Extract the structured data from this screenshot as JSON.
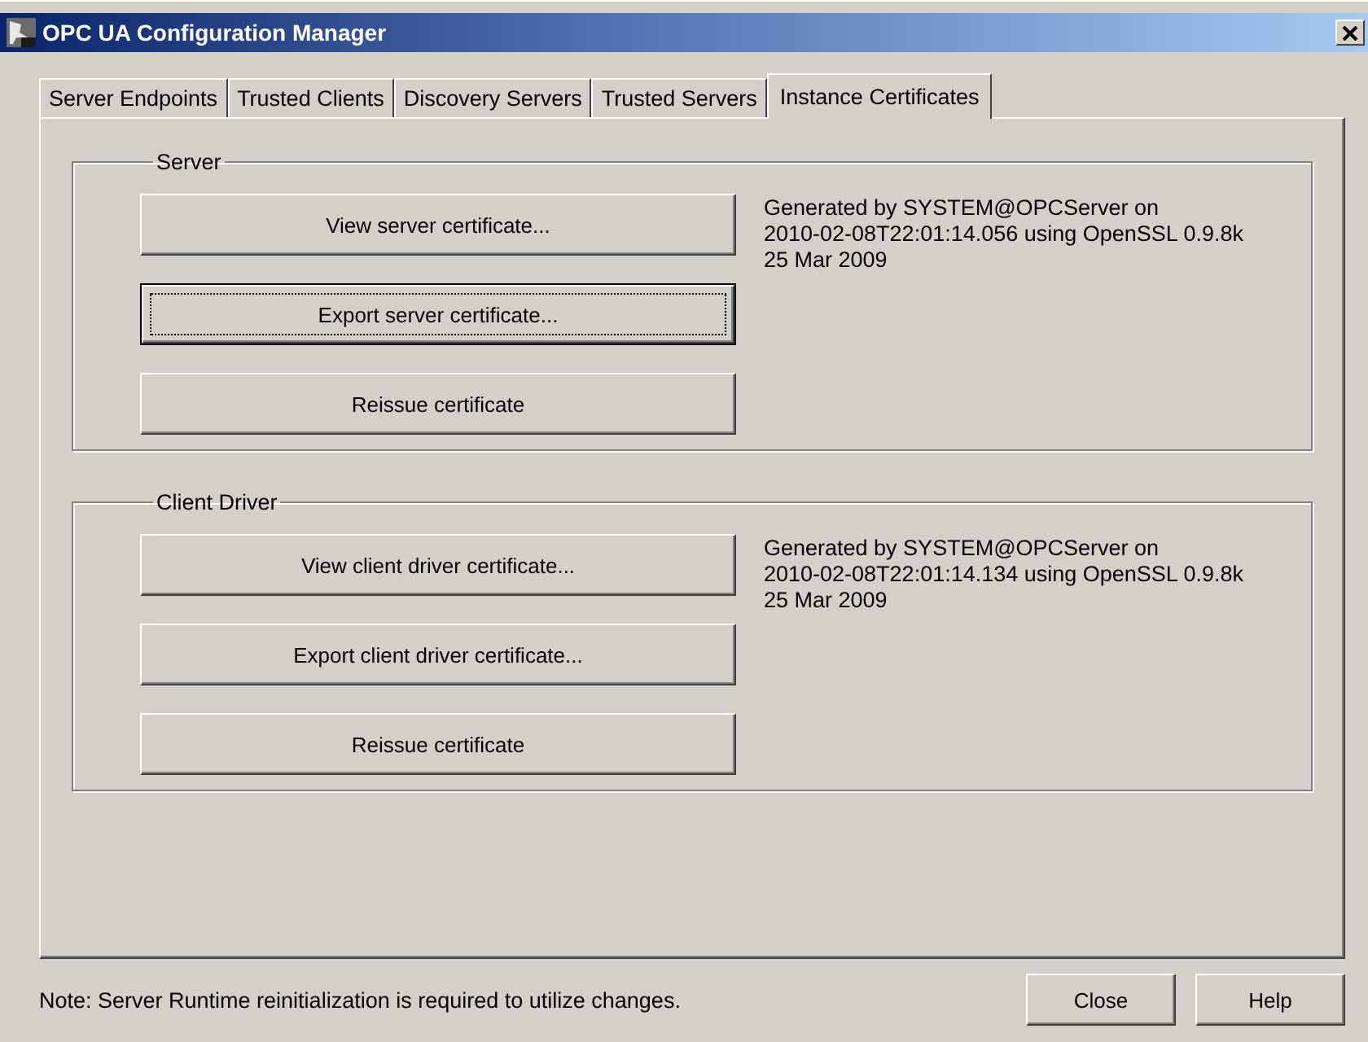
{
  "window": {
    "title": "OPC UA Configuration Manager"
  },
  "tabs": [
    {
      "label": "Server Endpoints",
      "selected": false
    },
    {
      "label": "Trusted Clients",
      "selected": false
    },
    {
      "label": "Discovery Servers",
      "selected": false
    },
    {
      "label": "Trusted Servers",
      "selected": false
    },
    {
      "label": "Instance Certificates",
      "selected": true
    }
  ],
  "groups": [
    {
      "title": "Server",
      "info": [
        "Generated by SYSTEM@OPCServer on",
        "2010-02-08T22:01:14.056 using OpenSSL 0.9.8k",
        "25 Mar 2009"
      ],
      "buttons": [
        {
          "label": "View server certificate...",
          "focused": false
        },
        {
          "label": "Export server certificate...",
          "focused": true
        },
        {
          "label": "Reissue certificate",
          "focused": false
        }
      ]
    },
    {
      "title": "Client Driver",
      "info": [
        "Generated by SYSTEM@OPCServer on",
        "2010-02-08T22:01:14.134 using OpenSSL 0.9.8k",
        "25 Mar 2009"
      ],
      "buttons": [
        {
          "label": "View client driver certificate...",
          "focused": false
        },
        {
          "label": "Export client driver certificate...",
          "focused": false
        },
        {
          "label": "Reissue certificate",
          "focused": false
        }
      ]
    }
  ],
  "note": "Note:  Server Runtime reinitialization is required to utilize changes.",
  "footer_buttons": [
    {
      "label": "Close"
    },
    {
      "label": "Help"
    }
  ]
}
